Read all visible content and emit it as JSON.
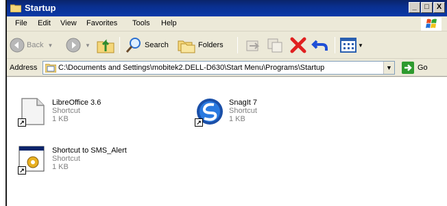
{
  "window": {
    "title": "Startup"
  },
  "controls": {
    "minimize": "_",
    "maximize": "□",
    "close": "X"
  },
  "menu": [
    "File",
    "Edit",
    "View",
    "Favorites",
    "Tools",
    "Help"
  ],
  "toolbar": {
    "back": "Back",
    "search": "Search",
    "folders": "Folders"
  },
  "address": {
    "label": "Address",
    "value": "C:\\Documents and Settings\\mobitek2.DELL-D630\\Start Menu\\Programs\\Startup",
    "go": "Go"
  },
  "files": [
    {
      "name": "LibreOffice 3.6",
      "type": "Shortcut",
      "size": "1 KB",
      "icon": "libreoffice-icon"
    },
    {
      "name": "SnagIt 7",
      "type": "Shortcut",
      "size": "1 KB",
      "icon": "snagit-icon"
    },
    {
      "name": "Shortcut to SMS_Alert",
      "type": "Shortcut",
      "size": "1 KB",
      "icon": "application-icon"
    }
  ],
  "colors": {
    "titlebar": "#0a246a",
    "chrome": "#ece9d8",
    "addressBorder": "#7f9db9"
  }
}
